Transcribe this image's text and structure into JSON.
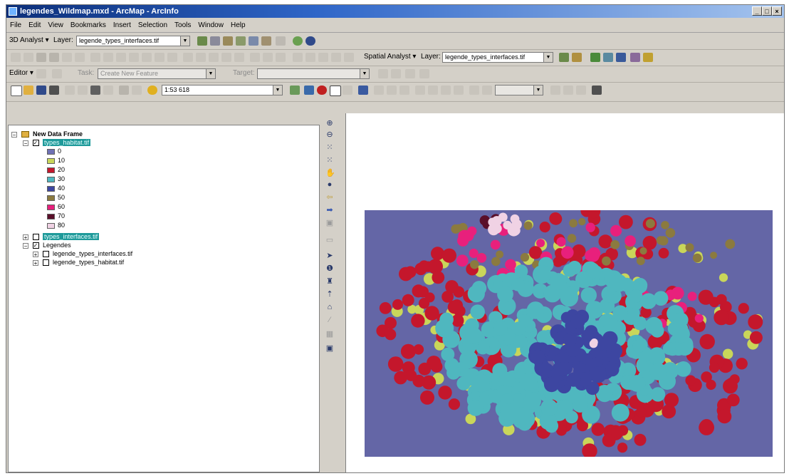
{
  "window": {
    "title": "legendes_Wildmap.mxd - ArcMap - ArcInfo",
    "controls": [
      "_",
      "□",
      "×"
    ]
  },
  "menu": [
    "File",
    "Edit",
    "View",
    "Bookmarks",
    "Insert",
    "Selection",
    "Tools",
    "Window",
    "Help"
  ],
  "toolbars": {
    "analyst3d": {
      "label": "3D Analyst ▾",
      "layer_label": "Layer:",
      "layer_value": "legende_types_interfaces.tif"
    },
    "spatial": {
      "label": "Spatial Analyst ▾",
      "layer_label": "Layer:",
      "layer_value": "legende_types_interfaces.tif"
    },
    "editor": {
      "label": "Editor ▾",
      "task_label": "Task:",
      "task_value": "Create New Feature",
      "target_label": "Target:",
      "target_value": ""
    },
    "standard": {
      "scale_value": "1:53 618"
    }
  },
  "toc": {
    "data_frame": "New Data Frame",
    "layer_habitat": "types_habitat.tif",
    "legend_items": [
      {
        "label": "0",
        "color": "#6f71b4"
      },
      {
        "label": "10",
        "color": "#c9d65a"
      },
      {
        "label": "20",
        "color": "#c4172c"
      },
      {
        "label": "30",
        "color": "#4fb7bf"
      },
      {
        "label": "40",
        "color": "#3d46a1"
      },
      {
        "label": "50",
        "color": "#8b7a3f"
      },
      {
        "label": "60",
        "color": "#e8207c"
      },
      {
        "label": "70",
        "color": "#5a0f2a"
      },
      {
        "label": "80",
        "color": "#f0d2e4"
      }
    ],
    "layer_interfaces": "types_interfaces.tif",
    "group_legendes": "Legendes",
    "sub_layers": [
      "legende_types_interfaces.tif",
      "legende_types_habitat.tif"
    ]
  },
  "map": {
    "background_color": "#6466a6",
    "colors": {
      "yellow": "#c9d65a",
      "red": "#c4172c",
      "cyan": "#4fb7bf",
      "navy": "#3d46a1",
      "olive": "#8b7a3f",
      "pink": "#e8207c",
      "maroon": "#5a0f2a",
      "lightpink": "#f0d2e4"
    }
  },
  "icons": {
    "vertical_tools": [
      "zoom-in-icon",
      "zoom-out-icon",
      "fixed-zoom-in-icon",
      "fixed-zoom-out-icon",
      "pan-icon",
      "full-extent-icon",
      "back-extent-icon",
      "forward-extent-icon",
      "select-elements-icon",
      "identify-icon",
      "find-icon",
      "go-to-xy-icon",
      "measure-icon",
      "hyperlink-icon",
      "html-popup-icon",
      "time-slider-icon"
    ]
  }
}
